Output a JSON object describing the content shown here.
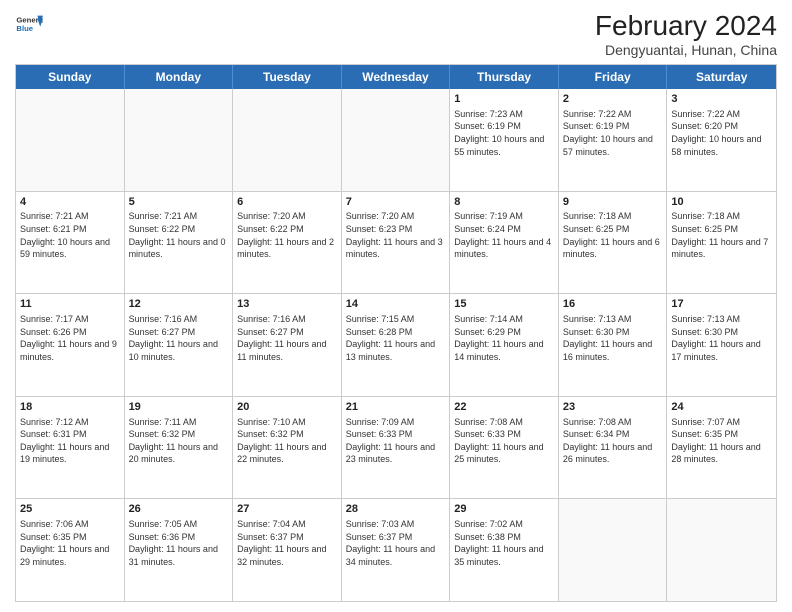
{
  "header": {
    "logo_general": "General",
    "logo_blue": "Blue",
    "month_year": "February 2024",
    "location": "Dengyuantai, Hunan, China"
  },
  "weekdays": [
    "Sunday",
    "Monday",
    "Tuesday",
    "Wednesday",
    "Thursday",
    "Friday",
    "Saturday"
  ],
  "rows": [
    [
      {
        "day": "",
        "sunrise": "",
        "sunset": "",
        "daylight": ""
      },
      {
        "day": "",
        "sunrise": "",
        "sunset": "",
        "daylight": ""
      },
      {
        "day": "",
        "sunrise": "",
        "sunset": "",
        "daylight": ""
      },
      {
        "day": "",
        "sunrise": "",
        "sunset": "",
        "daylight": ""
      },
      {
        "day": "1",
        "sunrise": "Sunrise: 7:23 AM",
        "sunset": "Sunset: 6:19 PM",
        "daylight": "Daylight: 10 hours and 55 minutes."
      },
      {
        "day": "2",
        "sunrise": "Sunrise: 7:22 AM",
        "sunset": "Sunset: 6:19 PM",
        "daylight": "Daylight: 10 hours and 57 minutes."
      },
      {
        "day": "3",
        "sunrise": "Sunrise: 7:22 AM",
        "sunset": "Sunset: 6:20 PM",
        "daylight": "Daylight: 10 hours and 58 minutes."
      }
    ],
    [
      {
        "day": "4",
        "sunrise": "Sunrise: 7:21 AM",
        "sunset": "Sunset: 6:21 PM",
        "daylight": "Daylight: 10 hours and 59 minutes."
      },
      {
        "day": "5",
        "sunrise": "Sunrise: 7:21 AM",
        "sunset": "Sunset: 6:22 PM",
        "daylight": "Daylight: 11 hours and 0 minutes."
      },
      {
        "day": "6",
        "sunrise": "Sunrise: 7:20 AM",
        "sunset": "Sunset: 6:22 PM",
        "daylight": "Daylight: 11 hours and 2 minutes."
      },
      {
        "day": "7",
        "sunrise": "Sunrise: 7:20 AM",
        "sunset": "Sunset: 6:23 PM",
        "daylight": "Daylight: 11 hours and 3 minutes."
      },
      {
        "day": "8",
        "sunrise": "Sunrise: 7:19 AM",
        "sunset": "Sunset: 6:24 PM",
        "daylight": "Daylight: 11 hours and 4 minutes."
      },
      {
        "day": "9",
        "sunrise": "Sunrise: 7:18 AM",
        "sunset": "Sunset: 6:25 PM",
        "daylight": "Daylight: 11 hours and 6 minutes."
      },
      {
        "day": "10",
        "sunrise": "Sunrise: 7:18 AM",
        "sunset": "Sunset: 6:25 PM",
        "daylight": "Daylight: 11 hours and 7 minutes."
      }
    ],
    [
      {
        "day": "11",
        "sunrise": "Sunrise: 7:17 AM",
        "sunset": "Sunset: 6:26 PM",
        "daylight": "Daylight: 11 hours and 9 minutes."
      },
      {
        "day": "12",
        "sunrise": "Sunrise: 7:16 AM",
        "sunset": "Sunset: 6:27 PM",
        "daylight": "Daylight: 11 hours and 10 minutes."
      },
      {
        "day": "13",
        "sunrise": "Sunrise: 7:16 AM",
        "sunset": "Sunset: 6:27 PM",
        "daylight": "Daylight: 11 hours and 11 minutes."
      },
      {
        "day": "14",
        "sunrise": "Sunrise: 7:15 AM",
        "sunset": "Sunset: 6:28 PM",
        "daylight": "Daylight: 11 hours and 13 minutes."
      },
      {
        "day": "15",
        "sunrise": "Sunrise: 7:14 AM",
        "sunset": "Sunset: 6:29 PM",
        "daylight": "Daylight: 11 hours and 14 minutes."
      },
      {
        "day": "16",
        "sunrise": "Sunrise: 7:13 AM",
        "sunset": "Sunset: 6:30 PM",
        "daylight": "Daylight: 11 hours and 16 minutes."
      },
      {
        "day": "17",
        "sunrise": "Sunrise: 7:13 AM",
        "sunset": "Sunset: 6:30 PM",
        "daylight": "Daylight: 11 hours and 17 minutes."
      }
    ],
    [
      {
        "day": "18",
        "sunrise": "Sunrise: 7:12 AM",
        "sunset": "Sunset: 6:31 PM",
        "daylight": "Daylight: 11 hours and 19 minutes."
      },
      {
        "day": "19",
        "sunrise": "Sunrise: 7:11 AM",
        "sunset": "Sunset: 6:32 PM",
        "daylight": "Daylight: 11 hours and 20 minutes."
      },
      {
        "day": "20",
        "sunrise": "Sunrise: 7:10 AM",
        "sunset": "Sunset: 6:32 PM",
        "daylight": "Daylight: 11 hours and 22 minutes."
      },
      {
        "day": "21",
        "sunrise": "Sunrise: 7:09 AM",
        "sunset": "Sunset: 6:33 PM",
        "daylight": "Daylight: 11 hours and 23 minutes."
      },
      {
        "day": "22",
        "sunrise": "Sunrise: 7:08 AM",
        "sunset": "Sunset: 6:33 PM",
        "daylight": "Daylight: 11 hours and 25 minutes."
      },
      {
        "day": "23",
        "sunrise": "Sunrise: 7:08 AM",
        "sunset": "Sunset: 6:34 PM",
        "daylight": "Daylight: 11 hours and 26 minutes."
      },
      {
        "day": "24",
        "sunrise": "Sunrise: 7:07 AM",
        "sunset": "Sunset: 6:35 PM",
        "daylight": "Daylight: 11 hours and 28 minutes."
      }
    ],
    [
      {
        "day": "25",
        "sunrise": "Sunrise: 7:06 AM",
        "sunset": "Sunset: 6:35 PM",
        "daylight": "Daylight: 11 hours and 29 minutes."
      },
      {
        "day": "26",
        "sunrise": "Sunrise: 7:05 AM",
        "sunset": "Sunset: 6:36 PM",
        "daylight": "Daylight: 11 hours and 31 minutes."
      },
      {
        "day": "27",
        "sunrise": "Sunrise: 7:04 AM",
        "sunset": "Sunset: 6:37 PM",
        "daylight": "Daylight: 11 hours and 32 minutes."
      },
      {
        "day": "28",
        "sunrise": "Sunrise: 7:03 AM",
        "sunset": "Sunset: 6:37 PM",
        "daylight": "Daylight: 11 hours and 34 minutes."
      },
      {
        "day": "29",
        "sunrise": "Sunrise: 7:02 AM",
        "sunset": "Sunset: 6:38 PM",
        "daylight": "Daylight: 11 hours and 35 minutes."
      },
      {
        "day": "",
        "sunrise": "",
        "sunset": "",
        "daylight": ""
      },
      {
        "day": "",
        "sunrise": "",
        "sunset": "",
        "daylight": ""
      }
    ]
  ]
}
